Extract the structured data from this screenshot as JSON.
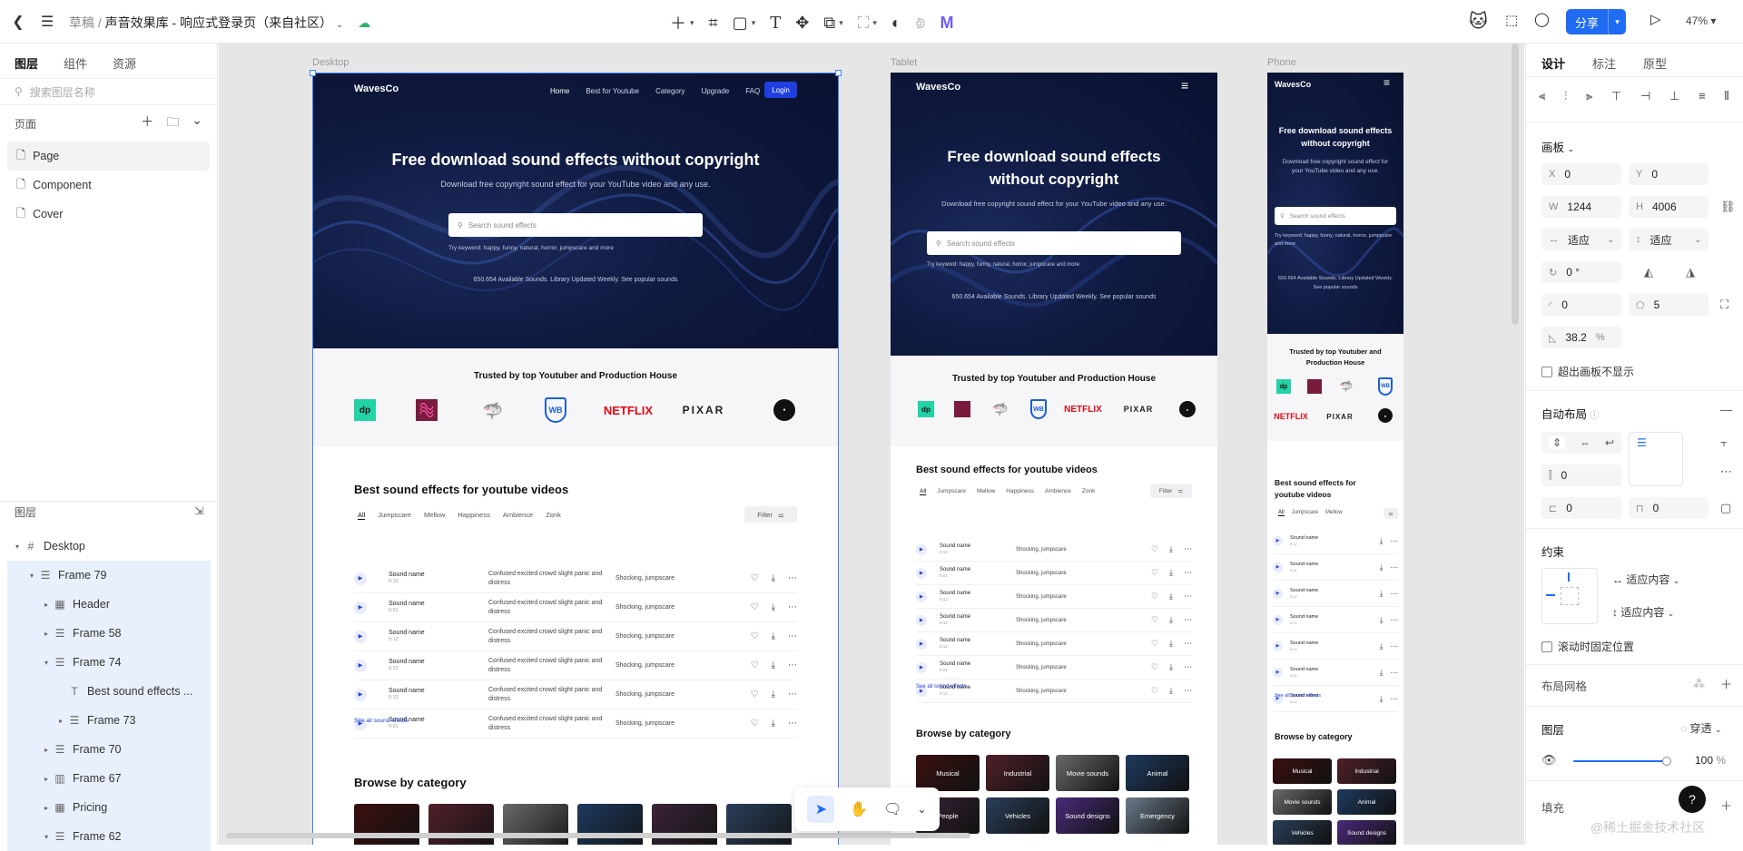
{
  "topbar": {
    "crumb_root": "草稿",
    "crumb_file": "声音效果库 - 响应式登录页（来自社区）",
    "share": "分享",
    "zoom": "47%"
  },
  "left": {
    "tabs": [
      "图层",
      "组件",
      "资源"
    ],
    "search_placeholder": "搜索图层名称",
    "pages_label": "页面",
    "pages": [
      "Page",
      "Component",
      "Cover"
    ],
    "layers_label": "图层",
    "layers": [
      {
        "name": "Desktop",
        "depth": 0,
        "tri": "▾",
        "icon": "#",
        "sel": false
      },
      {
        "name": "Frame 79",
        "depth": 1,
        "tri": "▾",
        "icon": "☰",
        "sel": true
      },
      {
        "name": "Header",
        "depth": 2,
        "tri": "▸",
        "icon": "▦",
        "sel": true
      },
      {
        "name": "Frame 58",
        "depth": 2,
        "tri": "▸",
        "icon": "☰",
        "sel": true
      },
      {
        "name": "Frame 74",
        "depth": 2,
        "tri": "▾",
        "icon": "☰",
        "sel": true
      },
      {
        "name": "Best sound effects ...",
        "depth": 3,
        "tri": "",
        "icon": "T",
        "sel": true
      },
      {
        "name": "Frame 73",
        "depth": 3,
        "tri": "▸",
        "icon": "☰",
        "sel": true
      },
      {
        "name": "Frame 70",
        "depth": 2,
        "tri": "▸",
        "icon": "☰",
        "sel": true
      },
      {
        "name": "Frame 67",
        "depth": 2,
        "tri": "▸",
        "icon": "▥",
        "sel": true
      },
      {
        "name": "Pricing",
        "depth": 2,
        "tri": "▸",
        "icon": "▦",
        "sel": true
      },
      {
        "name": "Frame 62",
        "depth": 2,
        "tri": "▾",
        "icon": "☰",
        "sel": true
      }
    ]
  },
  "canvas": {
    "labels": {
      "desktop": "Desktop",
      "tablet": "Tablet",
      "phone": "Phone"
    },
    "site": {
      "logo": "WavesCo",
      "nav": [
        "Home",
        "Best for Youtube",
        "Category",
        "Upgrade",
        "FAQ"
      ],
      "login": "Login",
      "hero_title": "Free download sound effects without copyright",
      "hero_title_l1": "Free download sound effects",
      "hero_title_l2": "without copyright",
      "hero_sub": "Download free copyright sound effect for your YouTube video and any use.",
      "search_placeholder": "Search sound effects",
      "try": "Try keyword: happy, funny, natural, horror, jumpscare and more",
      "stats": "650.654 Available Sounds. Library Updated Weekly. See popular sounds",
      "trusted": "Trusted by top Youtuber and Production House",
      "trusted_l1": "Trusted by top Youtuber and",
      "trusted_l2": "Production House",
      "brands": [
        "dp",
        "",
        "",
        "WB",
        "NETFLIX",
        "PIXAR",
        ""
      ],
      "best_title": "Best sound effects for youtube videos",
      "best_l1": "Best sound effects for",
      "best_l2": "youtube videos",
      "tabs": [
        "All",
        "Jumpscare",
        "Mellow",
        "Happiness",
        "Ambience",
        "Zonk"
      ],
      "filter": "Filter",
      "sound_name": "Sound name",
      "desc": "Confused excited crowd slight panic and distress",
      "tags": "Shocking, jumpscare",
      "durations": [
        "0:12",
        "0:01",
        "0:12",
        "0:12",
        "0:12",
        "0:01"
      ],
      "see_all": "See all sound effects",
      "browse": "Browse by category",
      "categories": [
        "Musical",
        "Industrial",
        "Movie sounds",
        "Animal",
        "People",
        "Vehicles",
        "Sound designs",
        "Emergency"
      ]
    }
  },
  "bottombar": {
    "tools": [
      "pointer",
      "hand",
      "comment",
      "more"
    ]
  },
  "right": {
    "tabs": [
      "设计",
      "标注",
      "原型"
    ],
    "frame_label": "画板",
    "x": "0",
    "y": "0",
    "w": "1244",
    "h": "4006",
    "fit_w": "适应",
    "fit_h": "适应",
    "rotation": "0 °",
    "radius": "0",
    "points": "5",
    "ratio": "38.2",
    "ratio_unit": "%",
    "clip": "超出画板不显示",
    "autolayout": "自动布局",
    "gap": "0",
    "pad_h": "0",
    "pad_v": "0",
    "constraint": "约束",
    "fit_content_h": "适应内容",
    "fit_content_v": "适应内容",
    "fixed_scroll": "滚动时固定位置",
    "grid": "布局网格",
    "layer": "图层",
    "blend": "穿透",
    "opacity": "100",
    "opacity_unit": "%",
    "fill": "填充",
    "help": "?",
    "watermark": "@稀土掘金技术社区"
  }
}
